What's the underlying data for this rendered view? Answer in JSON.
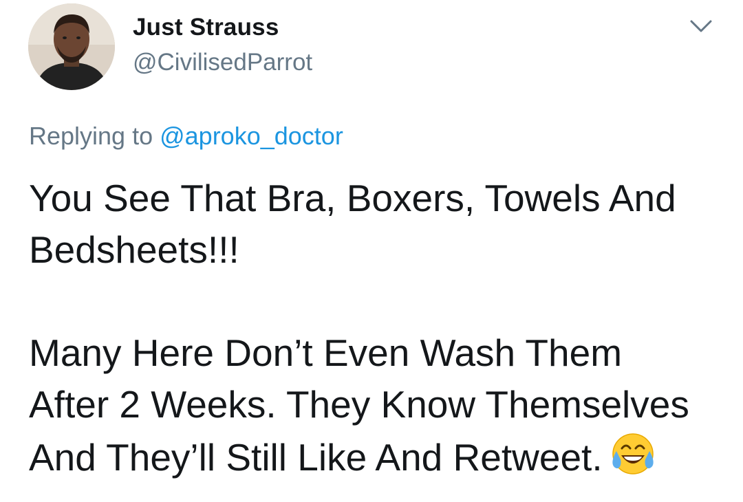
{
  "tweet": {
    "author": {
      "display_name": "Just Strauss",
      "handle": "@CivilisedParrot",
      "avatar_icon": "profile-photo"
    },
    "menu_icon": "chevron-down-icon",
    "reply": {
      "prefix": "Replying to ",
      "mention": "@aproko_doctor"
    },
    "text": {
      "paragraph_1": "You See That Bra, Boxers, Towels And\nBedsheets!!!",
      "paragraph_2": "Many Here Don’t Even Wash Them\nAfter 2 Weeks. They Know Themselves\nAnd They’ll Still Like And Retweet.",
      "emoji": "face-with-tears-of-joy"
    }
  },
  "colors": {
    "text_primary": "#14171a",
    "text_secondary": "#657786",
    "link": "#1b95e0",
    "background": "#ffffff"
  }
}
